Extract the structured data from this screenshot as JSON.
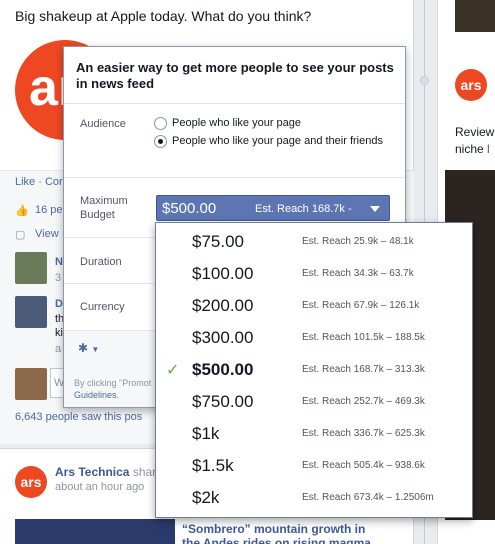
{
  "feed": {
    "post_text": "Big shakeup at Apple today. What do you think?",
    "ars_logo_big": "ar",
    "action_bar": "Like · Cor",
    "likes": "16 pe",
    "view": "View",
    "c1_name": "N",
    "c1_count": "3",
    "c2_name": "D",
    "c2_line1": "th",
    "c2_line2": "ki",
    "c2_line3": "a",
    "comment_placeholder": "W",
    "seen": "6,643 people saw this pos"
  },
  "post2": {
    "logo": "ars",
    "name": "Ars Technica",
    "shared": "shar",
    "time": "about an hour ago",
    "title": "“Sombrero” mountain growth in the Andes rides on rising magma"
  },
  "right_column": {
    "logo": "ars",
    "review_line1": "Review",
    "review_line2": "niche",
    "review_link": "l"
  },
  "popup": {
    "title": "An easier way to get more people to see your posts in news feed",
    "audience_label": "Audience",
    "audience_options": [
      {
        "label": "People who like your page",
        "selected": false
      },
      {
        "label": "People who like your page and their friends",
        "selected": true
      }
    ],
    "max_budget_label": "Maximum Budget",
    "duration_label": "Duration",
    "currency_label": "Currency",
    "selected_budget": "$500.00",
    "selected_reach": "Est. Reach 168.7k -",
    "footer_note_1": "By clicking \"Promot",
    "footer_note_2": "Guidelines."
  },
  "dropdown": {
    "options": [
      {
        "amount": "$75.00",
        "reach": "Est. Reach 25.9k – 48.1k",
        "selected": false
      },
      {
        "amount": "$100.00",
        "reach": "Est. Reach 34.3k – 63.7k",
        "selected": false
      },
      {
        "amount": "$200.00",
        "reach": "Est. Reach 67.9k – 126.1k",
        "selected": false
      },
      {
        "amount": "$300.00",
        "reach": "Est. Reach 101.5k – 188.5k",
        "selected": false
      },
      {
        "amount": "$500.00",
        "reach": "Est. Reach 168.7k – 313.3k",
        "selected": true
      },
      {
        "amount": "$750.00",
        "reach": "Est. Reach 252.7k – 469.3k",
        "selected": false
      },
      {
        "amount": "$1k",
        "reach": "Est. Reach 336.7k – 625.3k",
        "selected": false
      },
      {
        "amount": "$1.5k",
        "reach": "Est. Reach 505.4k – 938.6k",
        "selected": false
      },
      {
        "amount": "$2k",
        "reach": "Est. Reach 673.4k – 1.2506m",
        "selected": false
      }
    ]
  },
  "colors": {
    "facebook_blue": "#3b5998",
    "select_blue": "#5d76b3",
    "ars_orange": "#ee4823",
    "check_green": "#6aa84f"
  }
}
